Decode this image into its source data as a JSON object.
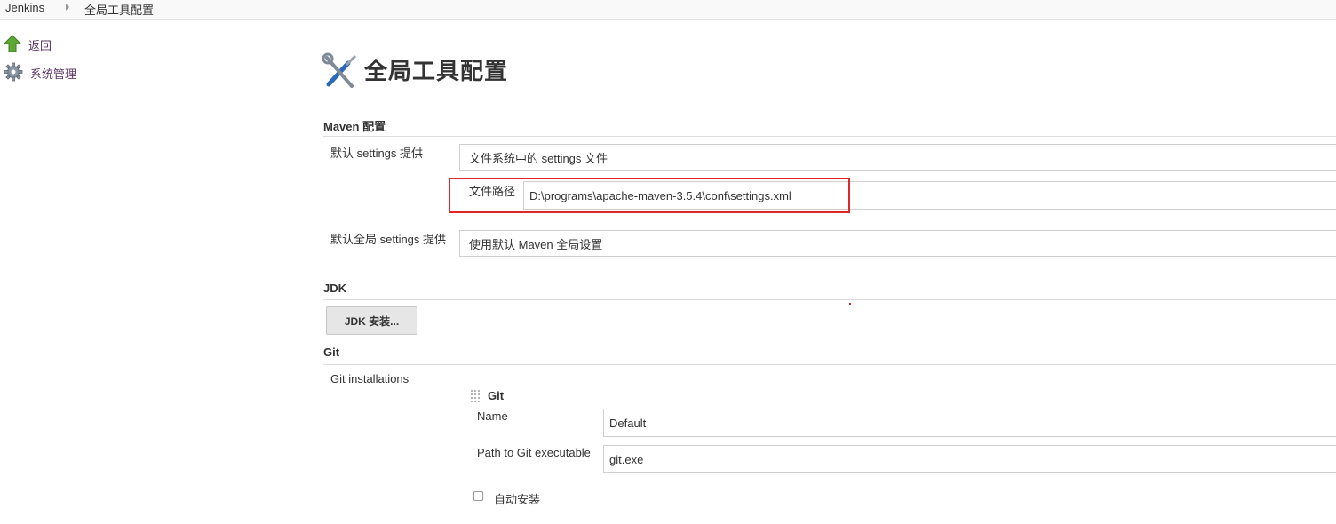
{
  "breadcrumb": {
    "items": [
      "Jenkins",
      "全局工具配置"
    ]
  },
  "sidebar": {
    "items": [
      {
        "label": "返回",
        "icon": "up-arrow-icon"
      },
      {
        "label": "系统管理",
        "icon": "gear-icon"
      }
    ]
  },
  "page": {
    "title": "全局工具配置",
    "icon": "tools-icon"
  },
  "maven": {
    "header": "Maven 配置",
    "settings_label": "默认 settings 提供",
    "settings_value": "文件系统中的 settings 文件",
    "path_label": "文件路径",
    "path_value": "D:\\programs\\apache-maven-3.5.4\\conf\\settings.xml",
    "global_label": "默认全局 settings 提供",
    "global_value": "使用默认 Maven 全局设置"
  },
  "jdk": {
    "header": "JDK",
    "button_label": "JDK 安装..."
  },
  "git": {
    "header": "Git",
    "installations_label": "Git installations",
    "block_title": "Git",
    "name_label": "Name",
    "name_value": "Default",
    "path_label": "Path to Git executable",
    "path_value": "git.exe",
    "auto_install_label": "自动安装"
  },
  "colors": {
    "highlight": "#e1262b",
    "link": "#5c3566",
    "arrow_green": "#5fa836"
  }
}
